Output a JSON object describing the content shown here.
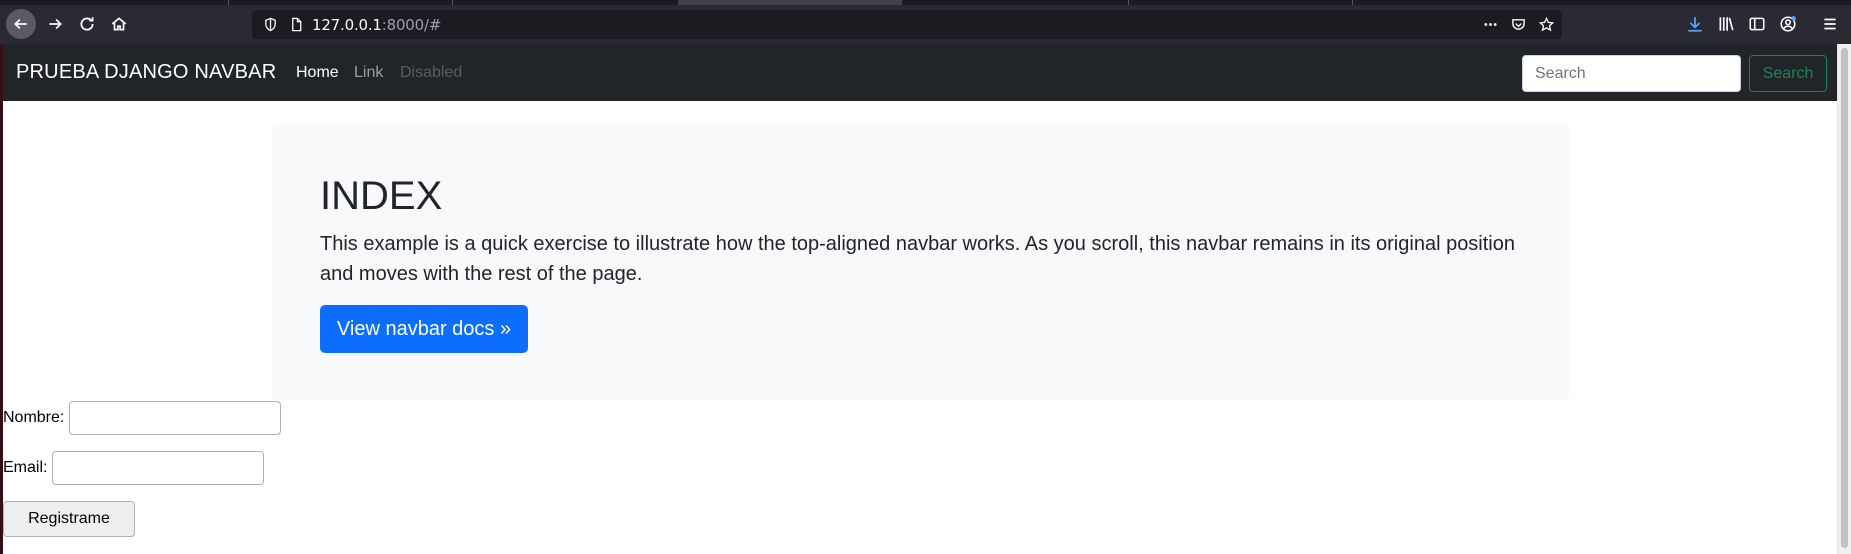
{
  "browser": {
    "url_host": "127.0.0.1",
    "url_rest": ":8000/#"
  },
  "navbar": {
    "brand": "PRUEBA DJANGO NAVBAR",
    "links": [
      {
        "label": "Home",
        "state": "active"
      },
      {
        "label": "Link",
        "state": "normal"
      },
      {
        "label": "Disabled",
        "state": "disabled"
      }
    ],
    "search_placeholder": "Search",
    "search_button": "Search"
  },
  "jumbotron": {
    "title": "INDEX",
    "lead": "This example is a quick exercise to illustrate how the top-aligned navbar works. As you scroll, this navbar remains in its original position and moves with the rest of the page.",
    "button": "View navbar docs »"
  },
  "form": {
    "nombre_label": "Nombre:",
    "nombre_value": "",
    "email_label": "Email:",
    "email_value": "",
    "submit_label": "Registrame"
  },
  "colors": {
    "navbar_bg": "#212529",
    "primary": "#0d6efd",
    "success": "#198754",
    "jumbotron_bg": "#f8f9fa"
  },
  "icons": [
    "back-icon",
    "forward-icon",
    "reload-icon",
    "home-icon",
    "shield-icon",
    "page-icon",
    "more-icon",
    "pocket-icon",
    "bookmark-star-icon",
    "download-icon",
    "library-icon",
    "sidebar-icon",
    "account-icon",
    "menu-icon"
  ]
}
